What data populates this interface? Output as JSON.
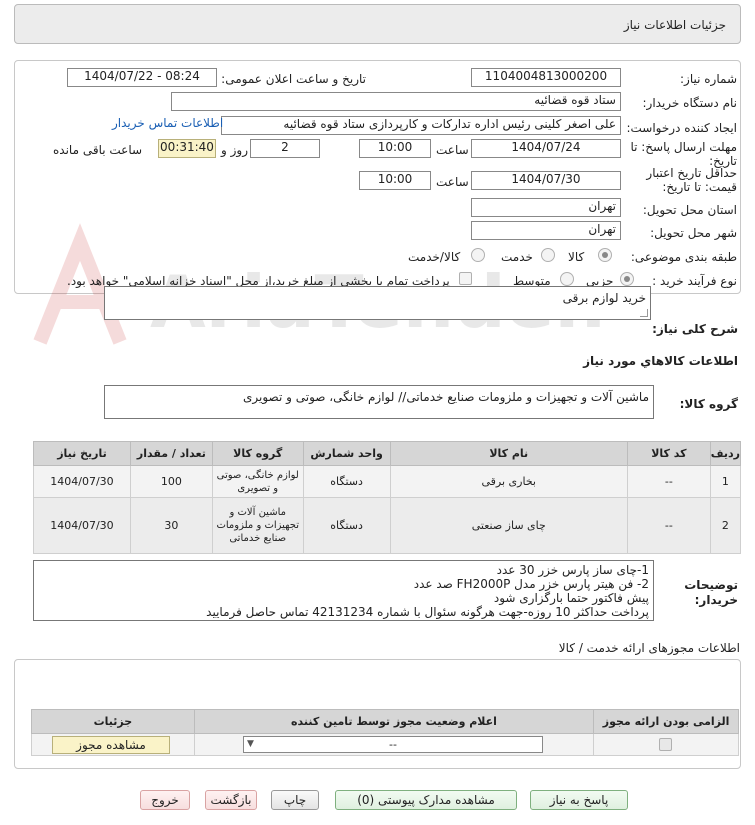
{
  "header": {
    "title": "جزئیات اطلاعات نیاز"
  },
  "form": {
    "need_number_label": "شماره نیاز:",
    "need_number": "1104004813000200",
    "announce_label": "تاریخ و ساعت اعلان عمومی:",
    "announce_value": "1404/07/22 - 08:24",
    "buyer_org_label": "نام دستگاه خریدار:",
    "buyer_org": "ستاد قوه قضائیه",
    "creator_label": "ایجاد کننده درخواست:",
    "creator": "علی اصغر کلینی رئیس اداره تدارکات و کارپردازی ستاد قوه قضائیه",
    "contact_link": "اطلاعات تماس خریدار",
    "deadline_label": "مهلت ارسال پاسخ: تا تاریخ:",
    "deadline_date": "1404/07/24",
    "time_label": "ساعت",
    "deadline_time": "10:00",
    "days": "2",
    "days_label": "روز و",
    "remaining": "00:31:40",
    "remaining_label": "ساعت باقی مانده",
    "validity_label": "حداقل تاریخ اعتبار قیمت: تا تاریخ:",
    "validity_date": "1404/07/30",
    "validity_time": "10:00",
    "province_label": "استان محل تحویل:",
    "province": "تهران",
    "city_label": "شهر محل تحویل:",
    "city": "تهران",
    "category_label": "طبقه بندی موضوعی:",
    "cat_goods": "کالا",
    "cat_service": "خدمت",
    "cat_goods_service": "کالا/خدمت",
    "process_label": "نوع فرآیند خرید :",
    "proc_partial": "جزیی",
    "proc_medium": "متوسط",
    "treasury_note": "پرداخت تمام یا بخشی از مبلغ خرید،از محل \"اسناد خزانه اسلامی\" خواهد بود."
  },
  "description": {
    "label": "شرح کلی نیاز:",
    "value": "خرید لوازم برقی",
    "goods_info_title": "اطلاعات کالاهاي مورد نياز"
  },
  "goods_group": {
    "label": "گروه کالا:",
    "value": "ماشین آلات و تجهیزات و ملزومات صنایع خدماتی// لوازم خانگی، صوتی و تصویری"
  },
  "items_table": {
    "headers": [
      "ردیف",
      "کد کالا",
      "نام کالا",
      "واحد شمارش",
      "گروه کالا",
      "تعداد / مقدار",
      "تاریخ نیاز"
    ],
    "rows": [
      [
        "1",
        "--",
        "بخاری برقی",
        "دستگاه",
        "لوازم خانگی، صوتی و تصویری",
        "100",
        "1404/07/30"
      ],
      [
        "2",
        "--",
        "چای ساز صنعتی",
        "دستگاه",
        "ماشین آلات و تجهیزات و ملزومات صنایع خدماتی",
        "30",
        "1404/07/30"
      ]
    ]
  },
  "buyer_notes": {
    "label": "توضیحات خریدار:",
    "lines": [
      "1-چای ساز پارس خزر 30 عدد",
      "2- فن هیتر پارس خزر مدل FH2000P صد عدد",
      "پیش فاکتور حتما بارگزاری شود",
      "پرداخت حداکثر 10 روزه-جهت هرگونه سئوال با شماره 42131234 تماس حاصل فرمایید"
    ]
  },
  "permits": {
    "title": "اطلاعات مجوزهای ارائه خدمت / کالا",
    "headers": [
      "الزامی بودن ارائه مجوز",
      "اعلام وضعیت مجوز توسط تامین کننده",
      "جزئیات"
    ],
    "select_value": "--",
    "view_button": "مشاهده مجوز"
  },
  "actions": {
    "reply": "پاسخ به نیاز",
    "attachments": "مشاهده مدارک پیوستی (0)",
    "print": "چاپ",
    "back": "بازگشت",
    "exit": "خروج"
  },
  "watermark": {
    "text": "AriaTender.neT"
  },
  "colors": {
    "link": "#1a5fb4",
    "header_bg": "#ececec",
    "timer_bg": "#faf3c8"
  }
}
